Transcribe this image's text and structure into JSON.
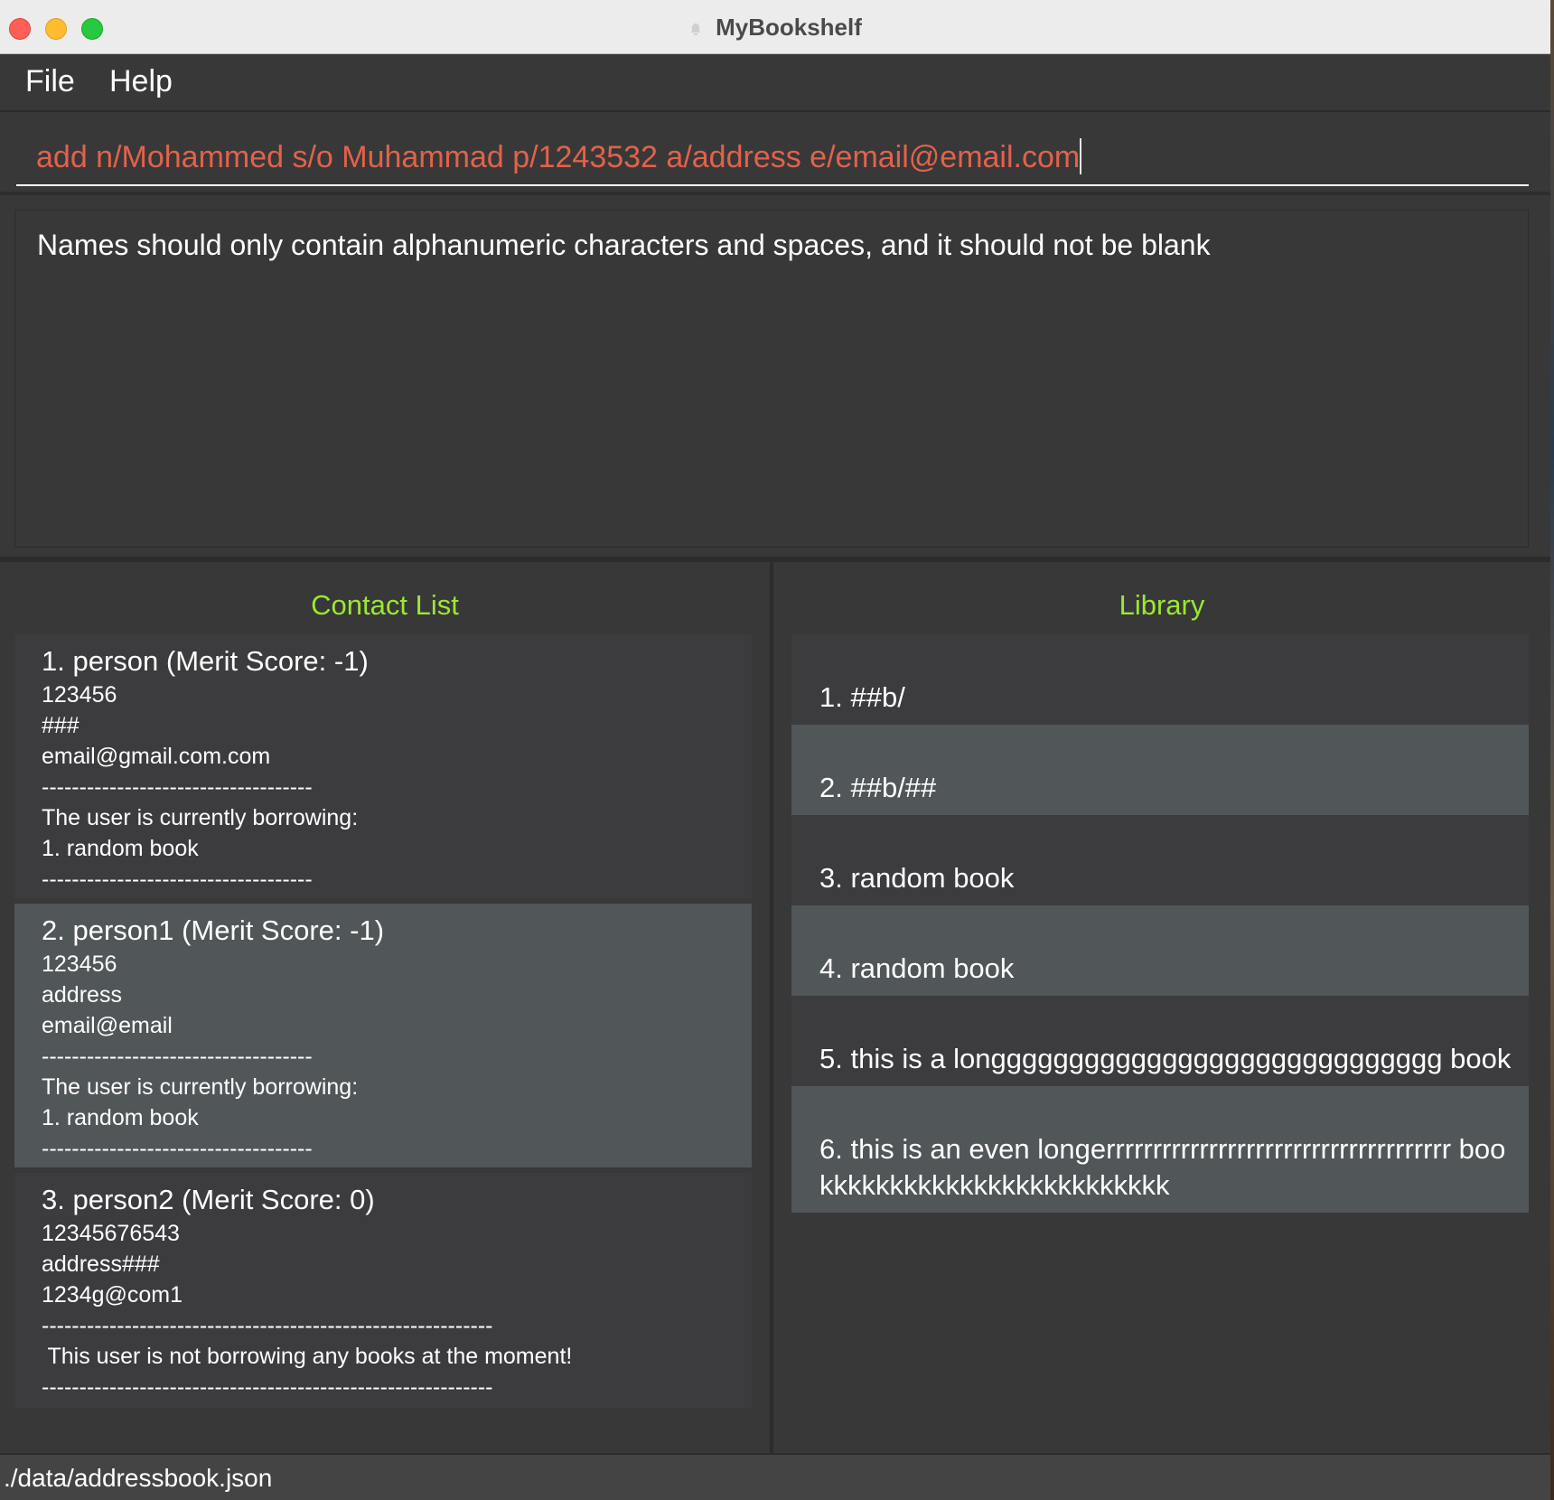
{
  "window": {
    "title": "MyBookshelf"
  },
  "menubar": {
    "file_label": "File",
    "help_label": "Help"
  },
  "command_box": {
    "value": "add n/Mohammed s/o Muhammad p/1243532 a/address e/email@email.com",
    "text_color": "#e2624b"
  },
  "result_display": {
    "message": "Names should only contain alphanumeric characters and spaces, and it should not be blank"
  },
  "contact_list": {
    "header": "Contact List",
    "header_color": "#9be830",
    "contacts": [
      {
        "heading": "1.  person  (Merit Score: -1)",
        "phone": "123456",
        "address": "###",
        "email": "email@gmail.com.com",
        "divider": "------------------------------------",
        "borrowing_label": "The user is currently borrowing:",
        "borrowed_book": "1. random book",
        "divider_end": "------------------------------------"
      },
      {
        "heading": "2.  person1  (Merit Score: -1)",
        "phone": "123456",
        "address": "address",
        "email": "email@email",
        "divider": "------------------------------------",
        "borrowing_label": "The user is currently borrowing:",
        "borrowed_book": "1. random book",
        "divider_end": "------------------------------------"
      },
      {
        "heading": "3.  person2  (Merit Score: 0)",
        "phone": "12345676543",
        "address": "address###",
        "email": "1234g@com1",
        "divider": "------------------------------------------------------------",
        "status": " This user is not borrowing any books at the moment!",
        "divider_end": "------------------------------------------------------------"
      }
    ]
  },
  "library": {
    "header": "Library",
    "books": [
      {
        "label": "1. ##b/"
      },
      {
        "label": "2. ##b/##"
      },
      {
        "label": "3. random book"
      },
      {
        "label": "4. random book"
      },
      {
        "label": "5. this is a longgggggggggggggggggggggggggggg book"
      },
      {
        "label": "6. this is an even longerrrrrrrrrrrrrrrrrrrrrrrrrrrrrrrrrrrrr bookkkkkkkkkkkkkkkkkkkkkkkkk"
      }
    ]
  },
  "status_bar": {
    "path": "./data/addressbook.json"
  }
}
